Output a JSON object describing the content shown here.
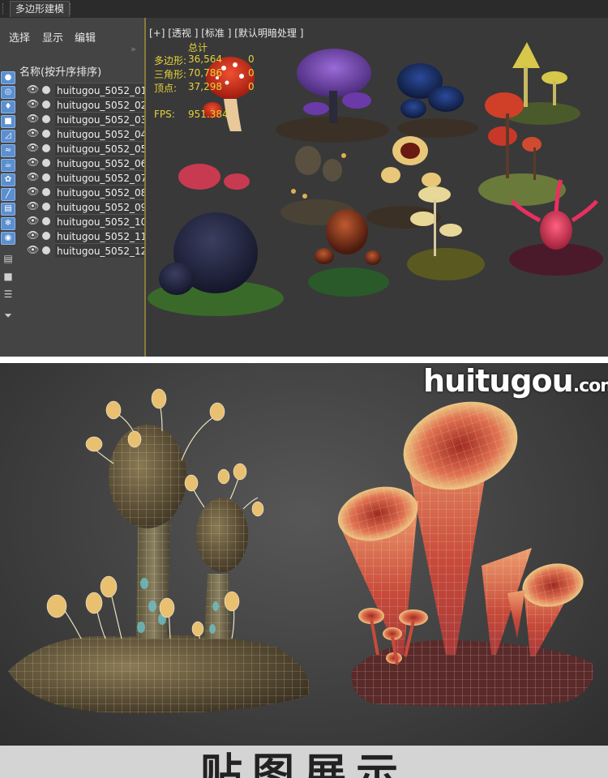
{
  "window": {
    "tab_title": "多边形建模"
  },
  "menu": {
    "select": "选择",
    "display": "显示",
    "edit": "编辑"
  },
  "toolbar_icons": [
    "sphere-icon",
    "shapes-icon",
    "light-icon",
    "camera-icon",
    "helper-icon",
    "spacewarp-icon",
    "teapot-icon",
    "particle-icon",
    "bone-icon",
    "layer-icon",
    "snowflake-icon",
    "visibility-icon",
    "document-icon",
    "box-icon",
    "properties-icon",
    "filter-icon"
  ],
  "scene_list": {
    "header": "名称(按升序排序)",
    "items": [
      {
        "name": "huitugou_5052_01"
      },
      {
        "name": "huitugou_5052_02"
      },
      {
        "name": "huitugou_5052_03"
      },
      {
        "name": "huitugou_5052_04"
      },
      {
        "name": "huitugou_5052_05"
      },
      {
        "name": "huitugou_5052_06"
      },
      {
        "name": "huitugou_5052_07"
      },
      {
        "name": "huitugou_5052_08"
      },
      {
        "name": "huitugou_5052_09"
      },
      {
        "name": "huitugou_5052_10"
      },
      {
        "name": "huitugou_5052_11"
      },
      {
        "name": "huitugou_5052_12"
      }
    ]
  },
  "viewport": {
    "label": "[+] [透视 ] [标准 ] [默认明暗处理 ]",
    "stats": {
      "total_label": "总计",
      "polygons_label": "多边形:",
      "polygons_value": "36,564",
      "polygons_sel": "0",
      "triangles_label": "三角形:",
      "triangles_value": "70,786",
      "triangles_sel": "0",
      "vertices_label": "顶点:",
      "vertices_value": "37,298",
      "vertices_sel": "0",
      "fps_label": "FPS:",
      "fps_value": "951.384"
    }
  },
  "watermark": {
    "main": "huitugou",
    "suffix": ".com"
  },
  "caption": "贴图展示",
  "colors": {
    "accent_blue": "#5b8fd0",
    "stat_yellow": "#e6d23a",
    "viewport_border": "#8a7a3a"
  }
}
